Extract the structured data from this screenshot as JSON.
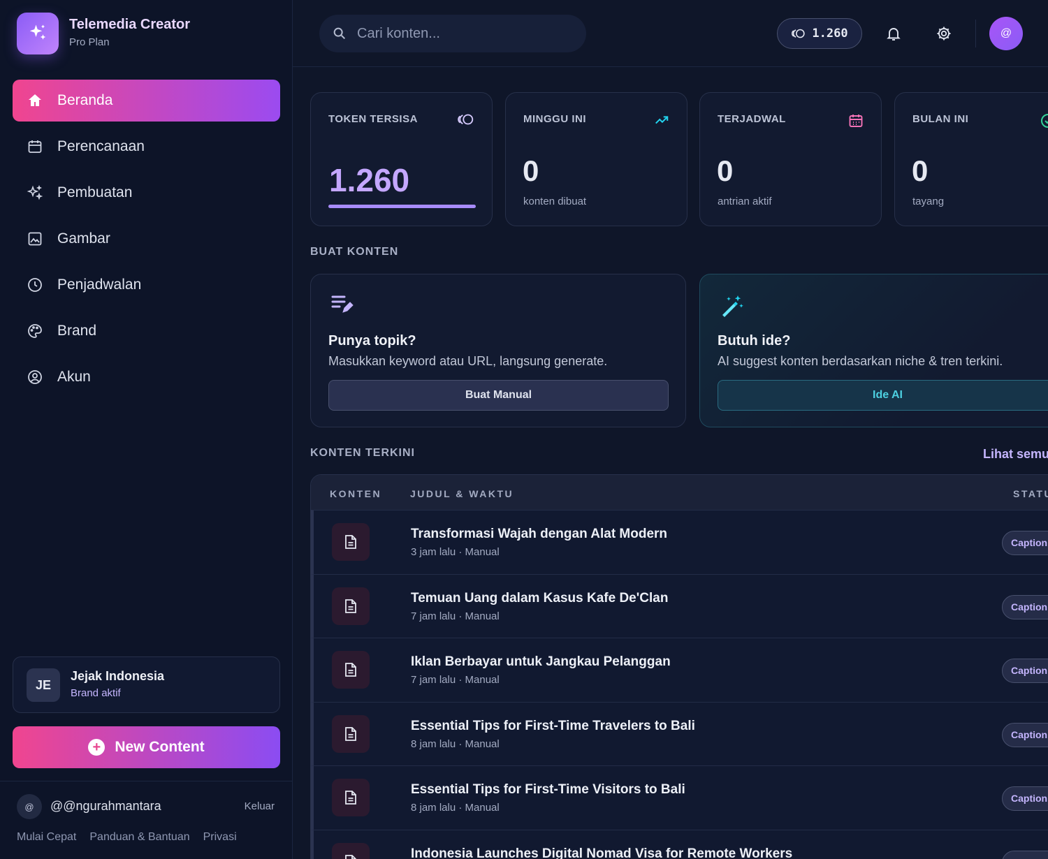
{
  "app": {
    "title": "Telemedia Creator",
    "plan": "Pro Plan"
  },
  "sidebar": {
    "items": [
      {
        "label": "Beranda",
        "icon": "home-icon",
        "active": true
      },
      {
        "label": "Perencanaan",
        "icon": "calendar-icon"
      },
      {
        "label": "Pembuatan",
        "icon": "sparkles-icon"
      },
      {
        "label": "Gambar",
        "icon": "image-icon"
      },
      {
        "label": "Penjadwalan",
        "icon": "clock-icon"
      },
      {
        "label": "Brand",
        "icon": "palette-icon"
      },
      {
        "label": "Akun",
        "icon": "user-circle-icon"
      }
    ],
    "brand_card": {
      "initials": "JE",
      "name": "Jejak Indonesia",
      "status": "Brand aktif"
    },
    "new_content_label": "New Content",
    "user": {
      "avatar": "@",
      "handle": "@@ngurahmantara",
      "logout": "Keluar"
    },
    "footer_links": [
      "Mulai Cepat",
      "Panduan & Bantuan",
      "Privasi"
    ]
  },
  "topbar": {
    "search_placeholder": "Cari konten...",
    "token_count": "1.260",
    "avatar": "@"
  },
  "stats": [
    {
      "label": "TOKEN TERSISA",
      "value": "1.260",
      "icon": "token-icon",
      "progress": 1.0
    },
    {
      "label": "MINGGU INI",
      "value": "0",
      "sub": "konten dibuat",
      "icon": "trending-up-icon"
    },
    {
      "label": "TERJADWAL",
      "value": "0",
      "sub": "antrian aktif",
      "icon": "calendar-icon"
    },
    {
      "label": "BULAN INI",
      "value": "0",
      "sub": "tayang",
      "icon": "check-circle-icon"
    }
  ],
  "create_section": {
    "heading": "BUAT KONTEN",
    "manual": {
      "title": "Punya topik?",
      "desc": "Masukkan keyword atau URL, langsung generate.",
      "button": "Buat Manual"
    },
    "ai": {
      "title": "Butuh ide?",
      "desc": "AI suggest konten berdasarkan niche & tren terkini.",
      "button": "Ide AI"
    }
  },
  "recent": {
    "heading": "KONTEN TERKINI",
    "see_all": "Lihat semua",
    "columns": [
      "KONTEN",
      "JUDUL & WAKTU",
      "STATUS"
    ],
    "rows": [
      {
        "title": "Transformasi Wajah dengan Alat Modern",
        "meta": "3 jam lalu · Manual",
        "status": "Caption"
      },
      {
        "title": "Temuan Uang dalam Kasus Kafe De'Clan",
        "meta": "7 jam lalu · Manual",
        "status": "Caption"
      },
      {
        "title": "Iklan Berbayar untuk Jangkau Pelanggan",
        "meta": "7 jam lalu · Manual",
        "status": "Caption"
      },
      {
        "title": "Essential Tips for First-Time Travelers to Bali",
        "meta": "8 jam lalu · Manual",
        "status": "Caption"
      },
      {
        "title": "Essential Tips for First-Time Visitors to Bali",
        "meta": "8 jam lalu · Manual",
        "status": "Caption"
      },
      {
        "title": "Indonesia Launches Digital Nomad Visa for Remote Workers",
        "meta": "",
        "status": "Caption"
      }
    ]
  },
  "colors": {
    "accent_pink": "#f0458f",
    "accent_purple": "#8b5cf6",
    "ai_cyan": "#4dd0e1",
    "background": "#0f1629"
  }
}
